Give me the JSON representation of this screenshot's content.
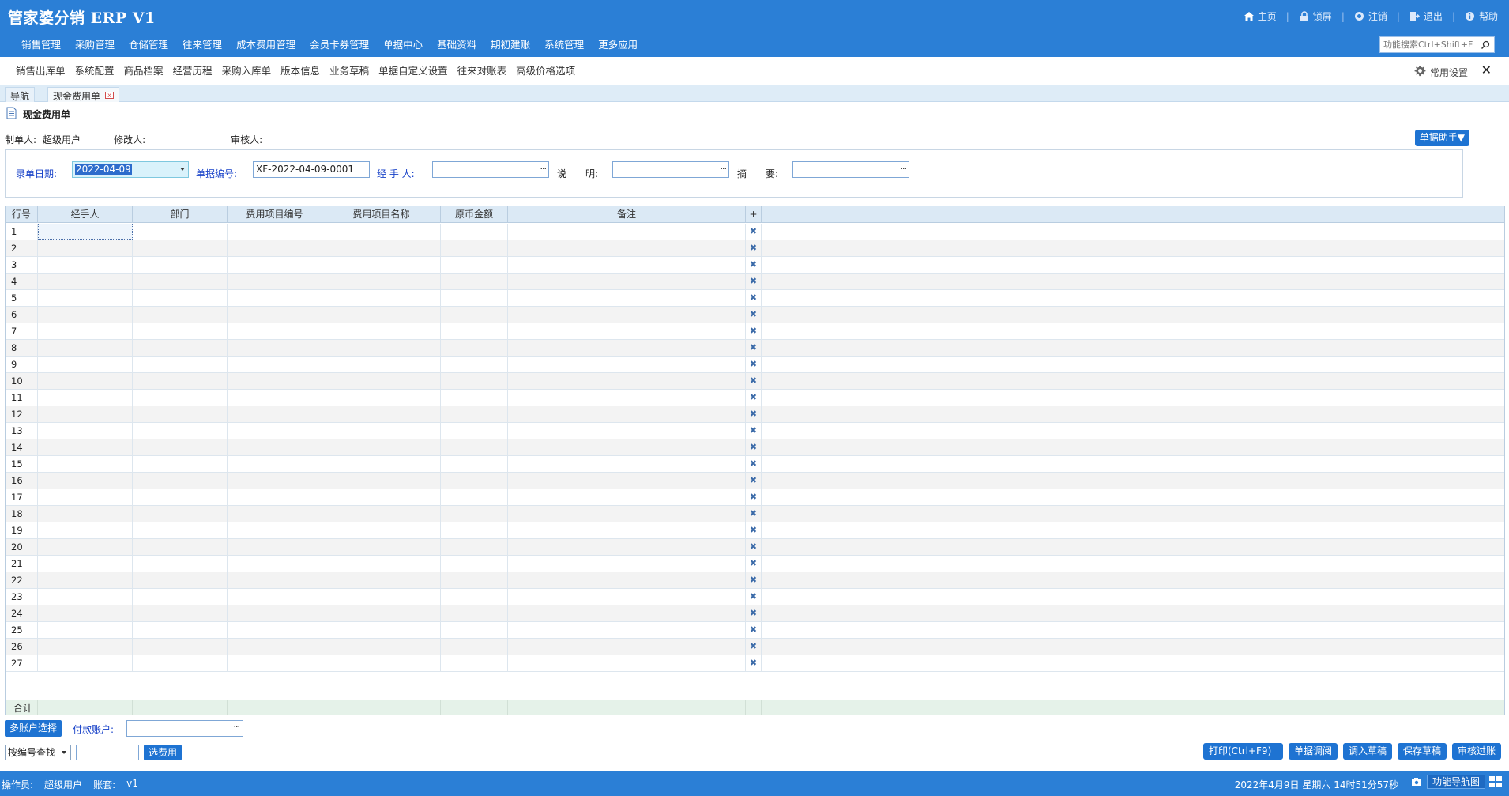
{
  "header": {
    "title": "管家婆分销 ERP V1",
    "links": [
      {
        "label": "主页",
        "icon": "home-icon"
      },
      {
        "label": "锁屏",
        "icon": "lock-icon"
      },
      {
        "label": "注销",
        "icon": "logout-circle-icon"
      },
      {
        "label": "退出",
        "icon": "exit-icon"
      },
      {
        "label": "帮助",
        "icon": "info-icon"
      }
    ],
    "nav": [
      "销售管理",
      "采购管理",
      "仓储管理",
      "往来管理",
      "成本费用管理",
      "会员卡券管理",
      "单据中心",
      "基础资料",
      "期初建账",
      "系统管理",
      "更多应用"
    ],
    "search_placeholder": "功能搜索Ctrl+Shift+F"
  },
  "quickbar": {
    "items": [
      "销售出库单",
      "系统配置",
      "商品档案",
      "经营历程",
      "采购入库单",
      "版本信息",
      "业务草稿",
      "单据自定义设置",
      "往来对账表",
      "高级价格选项"
    ],
    "settings_label": "常用设置",
    "close_label": "✕"
  },
  "tabs": [
    {
      "label": "导航"
    },
    {
      "label": "现金费用单",
      "close": "x"
    }
  ],
  "form": {
    "title": "现金费用单",
    "meta": [
      {
        "label": "制单人:",
        "value": "超级用户"
      },
      {
        "label": "修改人:",
        "value": ""
      },
      {
        "label": "审核人:",
        "value": ""
      }
    ],
    "helper_button": "单据助手▼",
    "fields": {
      "date_label": "录单日期:",
      "date_value": "2022-04-09",
      "number_label": "单据编号:",
      "number_value": "XF-2022-04-09-0001",
      "handler_label": "经 手 人:",
      "handler_value": "",
      "desc_label_1": "说",
      "desc_label_2": "明:",
      "desc_value": "",
      "summary_label_1": "摘",
      "summary_label_2": "要:",
      "summary_value": "",
      "dots": "···"
    }
  },
  "grid": {
    "columns": [
      "行号",
      "经手人",
      "部门",
      "费用项目编号",
      "费用项目名称",
      "原币金额",
      "备注",
      "+"
    ],
    "row_count": 27,
    "delete_glyph": "✖",
    "total_label": "合计"
  },
  "bottom": {
    "multi_account_button": "多账户选择",
    "pay_account_label": "付款账户:",
    "query_select_value": "按编号查找",
    "choose_fee_button": "选费用",
    "actions": [
      "打印(Ctrl+F9)",
      "单据调阅",
      "调入草稿",
      "保存草稿",
      "审核过账"
    ]
  },
  "status": {
    "operator_label": "操作员:",
    "operator_value": "超级用户",
    "account_label": "账套:",
    "account_value": "v1",
    "datetime": "2022年4月9日  星期六  14时51分57秒",
    "nav_map_button": "功能导航图"
  },
  "colors": {
    "primary_blue": "#2b7fd6",
    "button_blue": "#1e73d2",
    "label_blue": "#1741c8"
  }
}
